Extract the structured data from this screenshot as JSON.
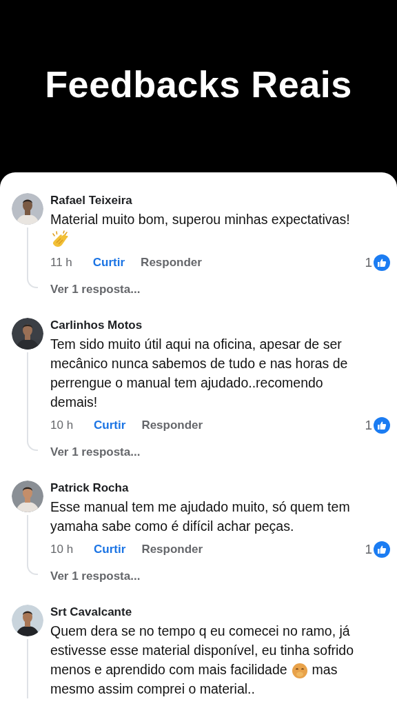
{
  "title": "Feedbacks Reais",
  "comments": [
    {
      "author": "Rafael Teixeira",
      "body": [
        {
          "kind": "text",
          "text": "Material muito bom, superou minhas expectativas!"
        },
        {
          "kind": "clap"
        }
      ],
      "time": "11 h",
      "like": "Curtir",
      "reply": "Responder",
      "likes": "1",
      "replies": "Ver 1 resposta..."
    },
    {
      "author": "Carlinhos Motos",
      "body": [
        {
          "kind": "text",
          "text": "Tem sido muito útil aqui na oficina, apesar de ser mecânico nunca sabemos de tudo e nas horas de perrengue o manual tem ajudado..recomendo demais!"
        }
      ],
      "time": "10 h",
      "like": "Curtir",
      "reply": "Responder",
      "likes": "1",
      "replies": "Ver 1 resposta..."
    },
    {
      "author": "Patrick Rocha",
      "body": [
        {
          "kind": "text",
          "text": "Esse manual tem me ajudado muito, só quem tem yamaha sabe como é difícil achar peças."
        }
      ],
      "time": "10 h",
      "like": "Curtir",
      "reply": "Responder",
      "likes": "1",
      "replies": "Ver 1 resposta..."
    },
    {
      "author": "Srt Cavalcante",
      "body": [
        {
          "kind": "text",
          "text": "Quem dera se no tempo q eu comecei no ramo, já estivesse esse material disponível, eu tinha sofrido"
        },
        {
          "kind": "text",
          "text": "menos e aprendido com mais facilidade"
        },
        {
          "kind": "shy"
        },
        {
          "kind": "text",
          "text": "mas"
        },
        {
          "kind": "text",
          "text": "mesmo assim comprei o material.."
        }
      ]
    }
  ]
}
